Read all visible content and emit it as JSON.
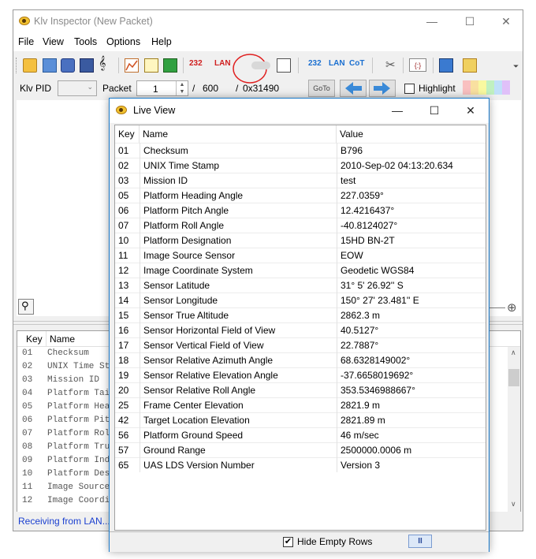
{
  "main_window": {
    "title": "Klv Inspector (New Packet)",
    "controls": {
      "minimize": "—",
      "maximize": "☐",
      "close": "✕"
    }
  },
  "menu": [
    "File",
    "View",
    "Tools",
    "Options",
    "Help"
  ],
  "toolbar": {
    "labels": {
      "serial_1": "232",
      "lan_1": "LAN",
      "serial_2": "232",
      "lan_2": "LAN",
      "cot": "CoT",
      "json": "{:}"
    },
    "icons": [
      "open-folder-icon",
      "save-icon",
      "export-icon",
      "print-icon",
      "music-clef-icon",
      "graph-icon",
      "edit-icon",
      "import-icon",
      "serial-232-icon",
      "lan-icon",
      "toggle-icon",
      "zoom-view-icon",
      "serial-232-icon",
      "lan-icon",
      "cot-icon",
      "tools-icon",
      "json-icon",
      "picture-icon",
      "map-icon",
      "overflow-icon"
    ],
    "accent_red": "#d02020",
    "accent_blue": "#1a6fd0"
  },
  "packet_bar": {
    "klv_pid_label": "Klv PID",
    "packet_label": "Packet",
    "packet_value": "1",
    "slash_1": "/",
    "packet_total": "600",
    "slash_2": "/",
    "offset": "0x31490",
    "goto_label": "GoTo",
    "highlight_label": "Highlight",
    "highlight_colors": [
      "#f9c0c0",
      "#f9e0a0",
      "#f9f9a0",
      "#c0f0c0",
      "#c0e0f9",
      "#e0c0f9"
    ]
  },
  "lower_table": {
    "headers": [
      "Key",
      "Name"
    ],
    "rows": [
      {
        "key": "01",
        "name": "Checksum"
      },
      {
        "key": "02",
        "name": "UNIX Time St"
      },
      {
        "key": "03",
        "name": "Mission ID"
      },
      {
        "key": "04",
        "name": "Platform Tai"
      },
      {
        "key": "05",
        "name": "Platform Hea"
      },
      {
        "key": "06",
        "name": "Platform Pit"
      },
      {
        "key": "07",
        "name": "Platform Rol"
      },
      {
        "key": "08",
        "name": "Platform Tru"
      },
      {
        "key": "09",
        "name": "Platform Ind"
      },
      {
        "key": "10",
        "name": "Platform Des"
      },
      {
        "key": "11",
        "name": "Image Source"
      },
      {
        "key": "12",
        "name": "Image Coordi"
      }
    ]
  },
  "status": {
    "text": "Receiving from LAN...",
    "color": "#1a3fd0"
  },
  "live_view": {
    "title": "Live View",
    "headers": {
      "key": "Key",
      "name": "Name",
      "value": "Value"
    },
    "rows": [
      {
        "key": "01",
        "name": "Checksum",
        "value": "B796"
      },
      {
        "key": "02",
        "name": "UNIX Time Stamp",
        "value": "2010-Sep-02 04:13:20.634"
      },
      {
        "key": "03",
        "name": "Mission ID",
        "value": "test"
      },
      {
        "key": "05",
        "name": "Platform Heading Angle",
        "value": "227.0359°"
      },
      {
        "key": "06",
        "name": "Platform Pitch Angle",
        "value": "12.4216437°"
      },
      {
        "key": "07",
        "name": "Platform Roll Angle",
        "value": "-40.8124027°"
      },
      {
        "key": "10",
        "name": "Platform Designation",
        "value": "15HD BN-2T"
      },
      {
        "key": "11",
        "name": "Image Source Sensor",
        "value": "EOW"
      },
      {
        "key": "12",
        "name": "Image Coordinate System",
        "value": "Geodetic WGS84"
      },
      {
        "key": "13",
        "name": "Sensor Latitude",
        "value": "31°  5' 26.92'' S"
      },
      {
        "key": "14",
        "name": "Sensor Longitude",
        "value": "150° 27' 23.481'' E"
      },
      {
        "key": "15",
        "name": "Sensor True Altitude",
        "value": "2862.3 m"
      },
      {
        "key": "16",
        "name": "Sensor Horizontal Field of View",
        "value": "40.5127°"
      },
      {
        "key": "17",
        "name": "Sensor Vertical Field of View",
        "value": "22.7887°"
      },
      {
        "key": "18",
        "name": "Sensor Relative Azimuth Angle",
        "value": "68.6328149002°"
      },
      {
        "key": "19",
        "name": "Sensor Relative Elevation Angle",
        "value": "-37.6658019692°"
      },
      {
        "key": "20",
        "name": "Sensor Relative Roll Angle",
        "value": "353.5346988667°"
      },
      {
        "key": "25",
        "name": "Frame Center Elevation",
        "value": "2821.9 m"
      },
      {
        "key": "42",
        "name": "Target Location Elevation",
        "value": "2821.89 m"
      },
      {
        "key": "56",
        "name": "Platform Ground Speed",
        "value": "46 m/sec"
      },
      {
        "key": "57",
        "name": "Ground Range",
        "value": "2500000.0006 m"
      },
      {
        "key": "65",
        "name": "UAS LDS Version Number",
        "value": "Version 3"
      }
    ],
    "hide_empty_rows_label": "Hide Empty Rows",
    "hide_empty_rows_checked": true,
    "pause_label": "II"
  }
}
